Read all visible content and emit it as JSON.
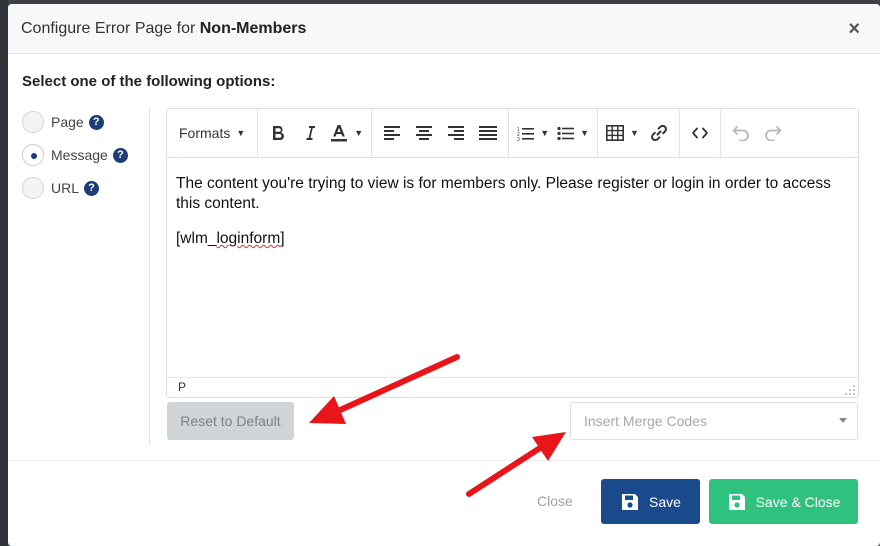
{
  "dialog": {
    "title_prefix": "Configure Error Page for ",
    "title_emphasis": "Non-Members",
    "close_glyph": "×"
  },
  "options": {
    "heading": "Select one of the following options:",
    "items": [
      {
        "label": "Page",
        "selected": false
      },
      {
        "label": "Message",
        "selected": true
      },
      {
        "label": "URL",
        "selected": false
      }
    ],
    "help_glyph": "?"
  },
  "editor": {
    "toolbar": {
      "formats_label": "Formats",
      "buttons": [
        "bold-icon",
        "italic-icon",
        "text-color-icon",
        "align-left-icon",
        "align-center-icon",
        "align-right-icon",
        "align-justify-icon",
        "numbered-list-icon",
        "bullet-list-icon",
        "table-icon",
        "link-icon",
        "code-icon",
        "undo-icon",
        "redo-icon"
      ]
    },
    "content": {
      "paragraph_1": "The content you're trying to view is for members only. Please register or login in order to access this content.",
      "shortcode_open": "[wlm_",
      "shortcode_word": "loginform",
      "shortcode_close": "]"
    },
    "statusbar_path": "P"
  },
  "actions": {
    "reset_label": "Reset to Default",
    "merge_placeholder": "Insert Merge Codes",
    "close_label": "Close",
    "save_label": "Save",
    "save_close_label": "Save & Close"
  },
  "colors": {
    "primary": "#1b4a8c",
    "success": "#2ec27e",
    "annotation_arrow": "#e8161b"
  }
}
